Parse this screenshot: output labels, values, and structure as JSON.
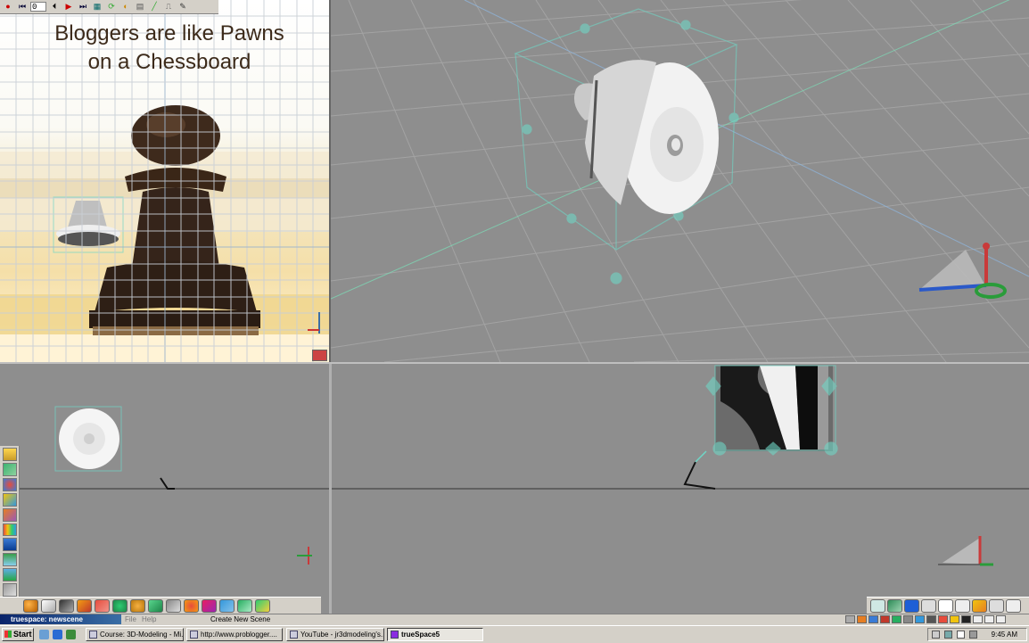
{
  "reference_view": {
    "frame_value": "0",
    "title_line1": "Bloggers are like Pawns",
    "title_line2": "on a Chessboard"
  },
  "app_status": {
    "scene_title": "truespace: newscene",
    "menu_file": "File",
    "menu_help": "Help",
    "message": "Create New Scene"
  },
  "taskbar": {
    "start_label": "Start",
    "tasks": [
      {
        "label": "Course: 3D-Modeling - Mi..."
      },
      {
        "label": "http://www.problogger...."
      },
      {
        "label": "YouTube - jr3dmodeling's..."
      },
      {
        "label": "trueSpace5"
      }
    ],
    "clock": "9:45 AM"
  },
  "colors": {
    "viewport_bg": "#8e8e8e",
    "grid_line": "#a0a0a0",
    "selection": "#6fd6c6",
    "panel": "#d4d0c8",
    "title_bar": "#0a246a"
  },
  "icons": {
    "ref_toolbar": [
      "record-icon",
      "rewind-icon",
      "play-back-icon",
      "play-icon",
      "forward-icon",
      "object-info-icon",
      "key-icon",
      "camera-icon",
      "render-icon",
      "brush-icon",
      "spline-icon",
      "edit-icon"
    ],
    "left_toolbar": [
      "object-tool-icon",
      "grid-tool-icon",
      "material-icon",
      "paint-icon",
      "blend-icon",
      "color-icon",
      "path-icon",
      "scene-icon",
      "landscape-icon",
      "tools-icon",
      "eye-icon"
    ],
    "bottom_toolbar": [
      "sphere-icon",
      "cube-icon",
      "pen-icon",
      "curve-icon",
      "deform-icon",
      "ball-icon",
      "shape-icon",
      "spline-icon",
      "sculpt-icon",
      "flower-icon",
      "pattern-icon",
      "line-icon",
      "arc-icon",
      "loft-icon"
    ],
    "right_toolbar": [
      "select-icon",
      "view-icon",
      "grid-icon",
      "layout-icon",
      "page-icon",
      "undo-icon",
      "pencil-icon",
      "play-icon",
      "close-icon"
    ]
  }
}
